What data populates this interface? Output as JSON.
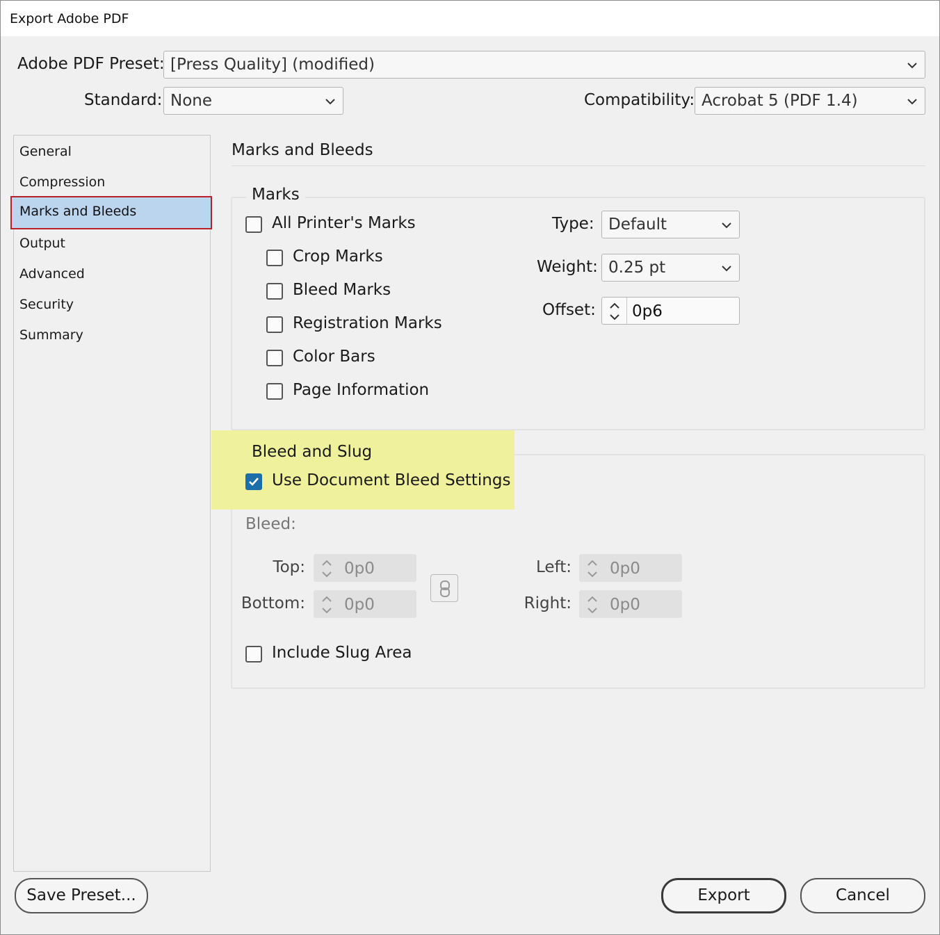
{
  "window": {
    "title": "Export Adobe PDF"
  },
  "top": {
    "preset_label": "Adobe PDF Preset:",
    "preset_value": "[Press Quality] (modified)",
    "standard_label": "Standard:",
    "standard_value": "None",
    "compatibility_label": "Compatibility:",
    "compatibility_value": "Acrobat 5 (PDF 1.4)"
  },
  "sidebar": {
    "items": [
      {
        "label": "General"
      },
      {
        "label": "Compression"
      },
      {
        "label": "Marks and Bleeds",
        "selected": true
      },
      {
        "label": "Output"
      },
      {
        "label": "Advanced"
      },
      {
        "label": "Security"
      },
      {
        "label": "Summary"
      }
    ]
  },
  "main": {
    "heading": "Marks and Bleeds",
    "marks": {
      "title": "Marks",
      "all_printers_marks": {
        "label": "All Printer's Marks",
        "checked": false
      },
      "options": [
        {
          "label": "Crop Marks",
          "checked": false
        },
        {
          "label": "Bleed Marks",
          "checked": false
        },
        {
          "label": "Registration Marks",
          "checked": false
        },
        {
          "label": "Color Bars",
          "checked": false
        },
        {
          "label": "Page Information",
          "checked": false
        }
      ],
      "type_label": "Type:",
      "type_value": "Default",
      "weight_label": "Weight:",
      "weight_value": "0.25 pt",
      "offset_label": "Offset:",
      "offset_value": "0p6"
    },
    "bleed_slug": {
      "title": "Bleed and Slug",
      "use_document_bleed": {
        "label": "Use Document Bleed Settings",
        "checked": true
      },
      "bleed_label": "Bleed:",
      "top_label": "Top:",
      "top_value": "0p0",
      "bottom_label": "Bottom:",
      "bottom_value": "0p0",
      "left_label": "Left:",
      "left_value": "0p0",
      "right_label": "Right:",
      "right_value": "0p0",
      "include_slug": {
        "label": "Include Slug Area",
        "checked": false
      }
    }
  },
  "footer": {
    "save_preset": "Save Preset...",
    "export": "Export",
    "cancel": "Cancel"
  },
  "colors": {
    "accent": "#1b6ea8",
    "selection": "#bcd5ef",
    "selection_border": "#b8202a",
    "highlight": "#eff19c"
  }
}
